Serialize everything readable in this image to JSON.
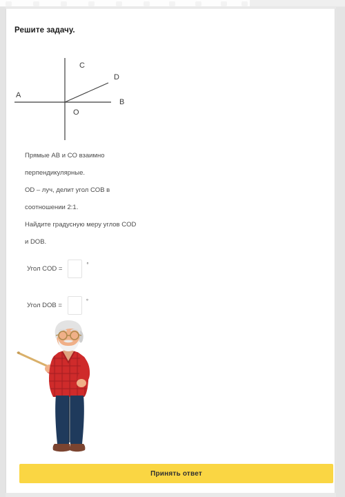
{
  "browser": {
    "toolbar_icon_count": 10
  },
  "task": {
    "title": "Решите задачу.",
    "statement_lines": [
      "Прямые AB и CO взаимно",
      "перпендикулярные.",
      "OD – луч, делит угол COB в",
      "соотношении 2:1.",
      "Найдите градусную меру углов COD",
      "и DOB."
    ]
  },
  "figure": {
    "labels": {
      "a": "A",
      "b": "B",
      "c": "C",
      "d": "D",
      "o": "O"
    },
    "line_color": "#3d3d3d"
  },
  "answers": [
    {
      "label": "Угол COD =",
      "value": "",
      "placeholder": "",
      "unit": "°"
    },
    {
      "label": "Угол DOB =",
      "value": "",
      "placeholder": "",
      "unit": "°"
    }
  ],
  "illustration": {
    "name": "teacher-with-pointer",
    "colors": {
      "hair": "#e3e3e3",
      "hair_shade": "#cfcfcf",
      "skin": "#f0b088",
      "skin_shade": "#e09b72",
      "beard": "#f2f2f2",
      "glasses": "#b08a4e",
      "sweater": "#cf2b2b",
      "sweater_dark": "#a81f22",
      "pants": "#1f3a5c",
      "pants_dark": "#16293f",
      "shoes": "#7b4430",
      "pointer": "#d9b06a"
    }
  },
  "submit": {
    "label": "Принять ответ",
    "color": "#fad643"
  }
}
